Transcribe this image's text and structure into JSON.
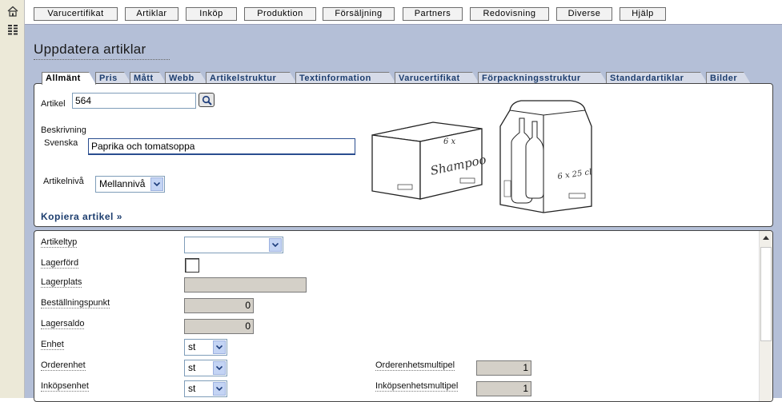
{
  "menu": [
    {
      "label": "Varucertifikat"
    },
    {
      "label": "Artiklar"
    },
    {
      "label": "Inköp"
    },
    {
      "label": "Produktion"
    },
    {
      "label": "Försäljning"
    },
    {
      "label": "Partners"
    },
    {
      "label": "Redovisning"
    },
    {
      "label": "Diverse"
    },
    {
      "label": "Hjälp"
    }
  ],
  "page": {
    "title": "Uppdatera artiklar"
  },
  "tabs": [
    {
      "label": "Allmänt"
    },
    {
      "label": "Pris"
    },
    {
      "label": "Mått"
    },
    {
      "label": "Webb"
    },
    {
      "label": "Artikelstruktur"
    },
    {
      "label": "Textinformation"
    },
    {
      "label": "Varucertifikat"
    },
    {
      "label": "Förpackningsstruktur"
    },
    {
      "label": "Standardartiklar"
    },
    {
      "label": "Bilder"
    }
  ],
  "article": {
    "label": "Artikel",
    "value": "564",
    "description_label": "Beskrivning",
    "swedish_label": "Svenska",
    "swedish_value": "Paprika och tomatsoppa",
    "level_label": "Artikelnivå",
    "level_value": "Mellannivå",
    "copy_link": "Kopiera artikel »"
  },
  "images": {
    "box_text_top": "6 x",
    "box_text_brand": "Shampoo",
    "box_label": "dynamic",
    "bottle_text": "6 x 25 cl"
  },
  "fields": {
    "type_label": "Artikeltyp",
    "type_value": "",
    "stocked_label": "Lagerförd",
    "location_label": "Lagerplats",
    "location_value": "",
    "reorder_label": "Beställningspunkt",
    "reorder_value": "0",
    "balance_label": "Lagersaldo",
    "balance_value": "0",
    "unit_label": "Enhet",
    "unit_value": "st",
    "order_unit_label": "Orderenhet",
    "order_unit_value": "st",
    "order_multiple_label": "Orderenhetsmultipel",
    "order_multiple_value": "1",
    "purchase_unit_label": "Inköpsenhet",
    "purchase_unit_value": "st",
    "purchase_multiple_label": "Inköpsenhetsmultipel",
    "purchase_multiple_value": "1"
  }
}
